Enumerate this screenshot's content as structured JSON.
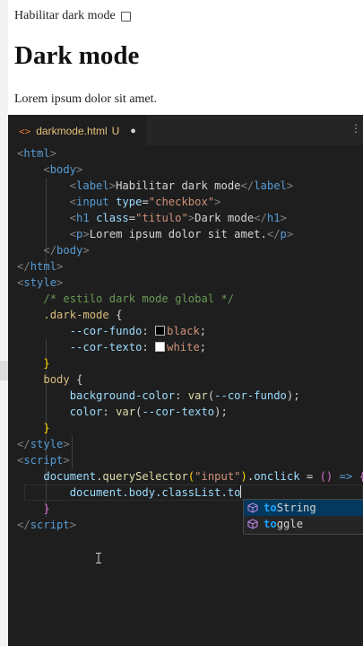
{
  "preview": {
    "checkbox_label": "Habilitar dark mode",
    "heading": "Dark mode",
    "paragraph": "Lorem ipsum dolor sit amet."
  },
  "tab": {
    "icon": "<>",
    "filename": "darkmode.html",
    "status": "U",
    "dirty": "●"
  },
  "code": {
    "l1": "html",
    "l2": "body",
    "l3_tag": "label",
    "l3_text": "Habilitar dark mode",
    "l4_tag": "input",
    "l4_attr": "type",
    "l4_val": "\"checkbox\"",
    "l5_tag": "h1",
    "l5_attr": "class",
    "l5_val": "\"titulo\"",
    "l5_text": "Dark mode",
    "l6_tag": "p",
    "l6_text": "Lorem ipsum dolor sit amet.",
    "l7": "body",
    "l8": "html",
    "l9": "style",
    "l10": "/* estilo dark mode global */",
    "l11_sel": ".dark-mode",
    "l12_prop": "--cor-fundo",
    "l12_val": "black",
    "l13_prop": "--cor-texto",
    "l13_val": "white",
    "l15_sel": "body",
    "l16_prop": "background-color",
    "l16_fn": "var",
    "l16_arg": "--cor-fundo",
    "l17_prop": "color",
    "l17_fn": "var",
    "l17_arg": "--cor-texto",
    "l19": "style",
    "l20": "script",
    "l21_obj": "document",
    "l21_method": "querySelector",
    "l21_arg": "\"input\"",
    "l21_prop": "onclick",
    "l22_chain": "document.body.classList.to",
    "l24": "script"
  },
  "suggestions": [
    {
      "match": "to",
      "rest": "String",
      "icon": "method-cube-icon"
    },
    {
      "match": "to",
      "rest": "ggle",
      "icon": "method-cube-icon"
    }
  ],
  "colors": {
    "editor_bg": "#1e1e1e",
    "tag": "#569cd6",
    "attribute": "#9cdcfe",
    "string": "#ce9178",
    "comment": "#6a9955",
    "selector": "#d7ba7d",
    "function": "#dcdcaa",
    "match_highlight": "#18a3ff",
    "active_suggestion": "#04395e"
  }
}
